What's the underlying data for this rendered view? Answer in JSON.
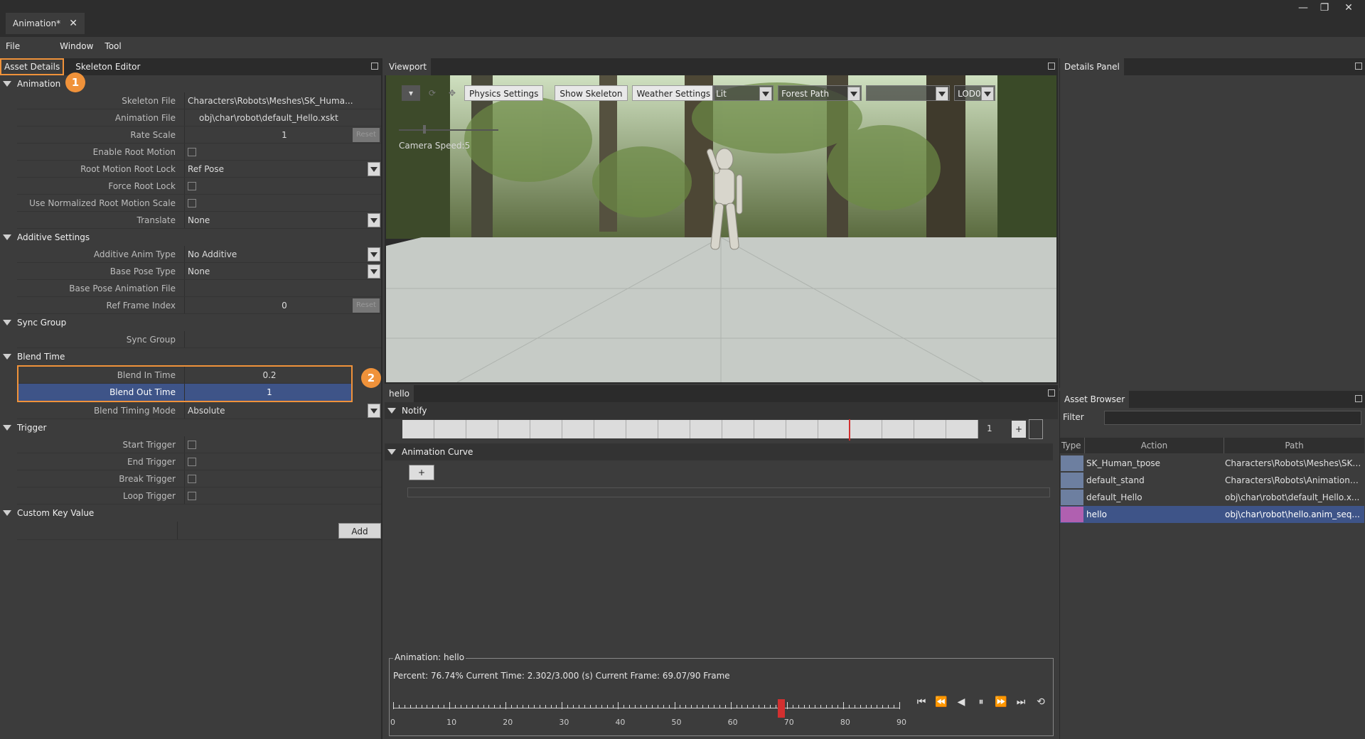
{
  "window": {
    "tab_title": "Animation*",
    "close_glyph": "✕",
    "min_glyph": "—",
    "restore_glyph": "❐",
    "close_window_glyph": "✕"
  },
  "menu": {
    "items": [
      "File",
      "Window",
      "Tool"
    ]
  },
  "left_panel": {
    "tabs": [
      "Asset Details",
      "Skeleton Editor"
    ],
    "sections": {
      "animation": "Animation",
      "additive": "Additive Settings",
      "sync": "Sync Group",
      "blend": "Blend Time",
      "trigger": "Trigger",
      "custom": "Custom Key Value"
    },
    "badge1": "1",
    "badge2": "2",
    "rows": {
      "skeleton_file": {
        "label": "Skeleton File",
        "value": "Characters\\Robots\\Meshes\\SK_Huma..."
      },
      "animation_file": {
        "label": "Animation File",
        "value": "obj\\char\\robot\\default_Hello.xskt"
      },
      "rate_scale": {
        "label": "Rate Scale",
        "value": "1",
        "reset": "Reset"
      },
      "enable_root_motion": {
        "label": "Enable Root Motion"
      },
      "root_motion_root_lock": {
        "label": "Root Motion Root Lock",
        "value": "Ref Pose"
      },
      "force_root_lock": {
        "label": "Force Root Lock"
      },
      "use_normalized": {
        "label": "Use Normalized Root Motion Scale"
      },
      "translate": {
        "label": "Translate",
        "value": "None"
      },
      "additive_anim_type": {
        "label": "Additive Anim Type",
        "value": "No Additive"
      },
      "base_pose_type": {
        "label": "Base Pose Type",
        "value": "None"
      },
      "base_pose_anim_file": {
        "label": "Base Pose Animation File",
        "value": ""
      },
      "ref_frame_index": {
        "label": "Ref Frame Index",
        "value": "0",
        "reset": "Reset"
      },
      "sync_group": {
        "label": "Sync Group",
        "value": ""
      },
      "blend_in_time": {
        "label": "Blend In Time",
        "value": "0.2"
      },
      "blend_out_time": {
        "label": "Blend Out Time",
        "value": "1"
      },
      "blend_timing_mode": {
        "label": "Blend Timing Mode",
        "value": "Absolute"
      },
      "start_trigger": {
        "label": "Start Trigger"
      },
      "end_trigger": {
        "label": "End Trigger"
      },
      "break_trigger": {
        "label": "Break Trigger"
      },
      "loop_trigger": {
        "label": "Loop Trigger"
      }
    },
    "add_button": "Add"
  },
  "viewport": {
    "title": "Viewport",
    "buttons": {
      "physics": "Physics Settings",
      "show_skeleton": "Show Skeleton",
      "weather": "Weather Settings"
    },
    "dropdowns": {
      "lit": "Lit",
      "scene": "Forest Path",
      "empty": "",
      "lod": "LOD0"
    },
    "camera_speed": "Camera Speed:5"
  },
  "sequence_panel": {
    "title": "hello",
    "notify": "Notify",
    "notify_count": "1",
    "plus": "+",
    "animation_curve": "Animation Curve"
  },
  "playback": {
    "group_title": "Animation: hello",
    "status": "Percent: 76.74% Current Time: 2.302/3.000 (s) Current Frame: 69.07/90 Frame",
    "ticks": [
      "0",
      "10",
      "20",
      "30",
      "40",
      "50",
      "60",
      "70",
      "80",
      "90"
    ],
    "current_frame": 69.07,
    "max_frame": 90,
    "controls": [
      "⏮",
      "⏪",
      "◀",
      "⏸",
      "⏩",
      "⏭",
      "⟲"
    ]
  },
  "details_panel": {
    "title": "Details Panel"
  },
  "asset_browser": {
    "title": "Asset Browser",
    "filter_label": "Filter",
    "columns": [
      "Type",
      "Action",
      "Path"
    ],
    "rows": [
      {
        "action": "SK_Human_tpose",
        "path": "Characters\\Robots\\Meshes\\SK_..."
      },
      {
        "action": "default_stand",
        "path": "Characters\\Robots\\Animations\\..."
      },
      {
        "action": "default_Hello",
        "path": "obj\\char\\robot\\default_Hello.x..."
      },
      {
        "action": "hello",
        "path": "obj\\char\\robot\\hello.anim_seq..."
      }
    ]
  },
  "colors": {
    "accent": "#f0923a",
    "selection": "#3e5488",
    "playhead": "#d23030"
  }
}
